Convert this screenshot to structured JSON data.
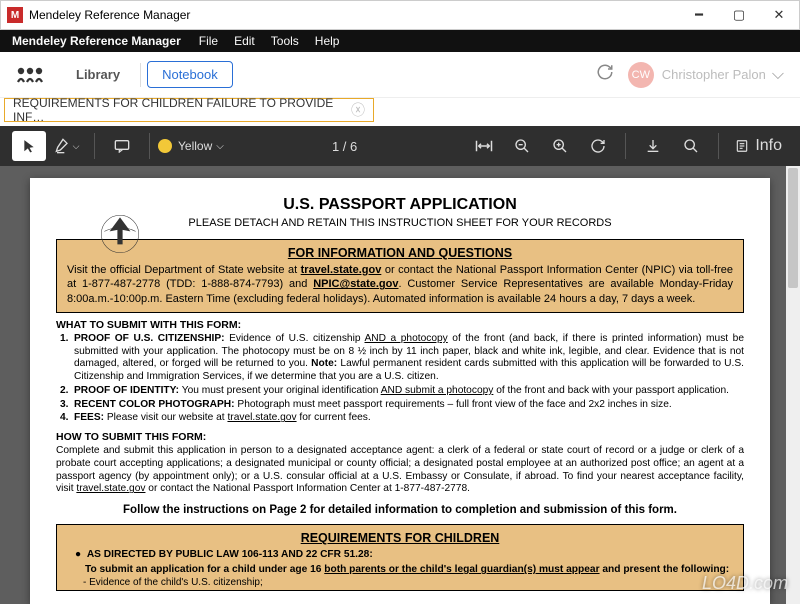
{
  "titlebar": {
    "app_name": "Mendeley Reference Manager"
  },
  "menu": {
    "title": "Mendeley Reference Manager",
    "items": [
      "File",
      "Edit",
      "Tools",
      "Help"
    ]
  },
  "header": {
    "library": "Library",
    "notebook": "Notebook",
    "user_initials": "CW",
    "user_name": "Christopher Palon"
  },
  "tab": {
    "label": "REQUIREMENTS FOR CHILDREN FAILURE TO PROVIDE INF…"
  },
  "toolbar": {
    "highlight_color": "Yellow",
    "page_indicator": "1 / 6",
    "info_label": "Info"
  },
  "document": {
    "title": "U.S. PASSPORT APPLICATION",
    "subtitle": "PLEASE DETACH AND RETAIN THIS INSTRUCTION SHEET FOR YOUR RECORDS",
    "info_box": {
      "heading": "FOR INFORMATION AND QUESTIONS",
      "text_parts": {
        "p1": "Visit the official Department of State website at ",
        "link1": "travel.state.gov",
        "p2": " or contact the National Passport Information Center (NPIC) via toll-free at 1-877-487-2778 (TDD: 1-888-874-7793) and ",
        "link2": "NPIC@state.gov",
        "p3": ".  Customer Service Representatives are available Monday-Friday 8:00a.m.-10:00p.m. Eastern Time (excluding federal holidays). Automated information is available 24 hours a day, 7 days a week."
      }
    },
    "what_submit": {
      "heading": "WHAT TO SUBMIT WITH THIS FORM:",
      "items": [
        {
          "n": "1.",
          "label": "PROOF OF U.S. CITIZENSHIP:",
          "t1": " Evidence of U.S. citizenship ",
          "u": "AND a photocopy",
          "t2": " of the front (and back, if there is printed information) must be submitted with your application. The photocopy must be on 8 ½ inch by 11 inch paper, black and white ink, legible, and clear. Evidence that is not damaged, altered, or forged will be returned to you. ",
          "note": "Note:",
          "t3": " Lawful permanent resident cards submitted with this application will be forwarded to U.S. Citizenship and Immigration Services, if we determine that you are a U.S. citizen."
        },
        {
          "n": "2.",
          "label": "PROOF OF IDENTITY:",
          "t1": " You must present your original identification ",
          "u": "AND submit a photocopy",
          "t2": " of the front and back with your passport application."
        },
        {
          "n": "3.",
          "label": "RECENT COLOR PHOTOGRAPH:",
          "t1": " Photograph must meet passport requirements – full front view of the face and 2x2 inches in size."
        },
        {
          "n": "4.",
          "label": "FEES:",
          "t1": " Please visit our website at ",
          "u": "travel.state.gov",
          "t2": " for current fees."
        }
      ]
    },
    "how_submit": {
      "heading": "HOW TO SUBMIT THIS FORM:",
      "para": "Complete and submit this application in person to a designated acceptance agent:  a clerk of a federal or state court of record or a judge or clerk of a probate court accepting applications; a designated municipal or county official; a designated postal employee at an authorized post office; an agent at a passport agency (by appointment only); or a U.S. consular official at a U.S. Embassy or Consulate, if abroad.  To find your nearest acceptance facility, visit ",
      "link": "travel.state.gov",
      "para2": " or contact the National Passport Information Center at 1-877-487-2778."
    },
    "footer_line": "Follow the instructions on Page 2 for detailed information to completion and submission of this form.",
    "children_box": {
      "heading": "REQUIREMENTS FOR CHILDREN",
      "bullet": "AS DIRECTED BY PUBLIC LAW 106-113 AND 22 CFR 51.28:",
      "sub_t1": "To submit an application for a child under age 16 ",
      "sub_u": "both parents or the child's legal guardian(s) must appear",
      "sub_t2": " and present the following:",
      "evidence": "Evidence of the child's U.S. citizenship;"
    }
  },
  "watermark": "LO4D.com"
}
